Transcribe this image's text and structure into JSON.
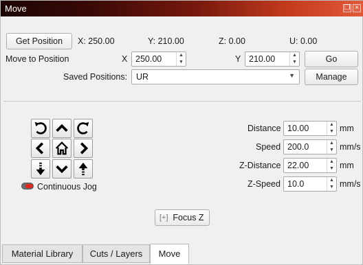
{
  "window": {
    "title": "Move"
  },
  "position": {
    "get_button": "Get Position",
    "x": "X: 250.00",
    "y": "Y: 210.00",
    "z": "Z: 0.00",
    "u": "U: 0.00"
  },
  "move_to": {
    "label": "Move to Position",
    "x_label": "X",
    "x_value": "250.00",
    "y_label": "Y",
    "y_value": "210.00",
    "go_button": "Go"
  },
  "saved": {
    "label": "Saved Positions:",
    "value": "UR",
    "manage_button": "Manage"
  },
  "jog": {
    "continuous_label": "Continuous Jog",
    "continuous_enabled": false,
    "toggle_color": "#e0281f"
  },
  "params": {
    "distance": {
      "label": "Distance",
      "value": "10.00",
      "unit": "mm"
    },
    "speed": {
      "label": "Speed",
      "value": "200.0",
      "unit": "mm/s"
    },
    "z_distance": {
      "label": "Z-Distance",
      "value": "22.00",
      "unit": "mm"
    },
    "z_speed": {
      "label": "Z-Speed",
      "value": "10.0",
      "unit": "mm/s"
    }
  },
  "focus_button": "Focus Z",
  "tabs": [
    {
      "label": "Material Library"
    },
    {
      "label": "Cuts / Layers"
    },
    {
      "label": "Move",
      "active": true
    }
  ]
}
